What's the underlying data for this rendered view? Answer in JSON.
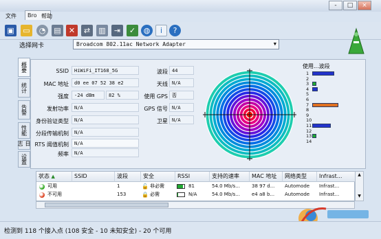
{
  "menu": {
    "file": "文件",
    "tab": "Bro",
    "help": "帮助"
  },
  "window_buttons": {
    "minimize": "-",
    "maximize": "□",
    "close": "×"
  },
  "adapter": {
    "label": "选择网卡",
    "selected": "Broadcom 802.11ac Network Adapter"
  },
  "side_tabs": [
    "概要",
    "统计",
    "告警",
    "性能",
    "日志",
    "设置"
  ],
  "details": {
    "ssid": {
      "label": "SSID",
      "value": "HiWiFi_IT168_5G"
    },
    "mac": {
      "label": "MAC 地址",
      "value": "d0 ee 07 52 38 e2"
    },
    "strength": {
      "label": "强度",
      "dbm": "-24 dBm",
      "pct": "82 %"
    },
    "tx_power": {
      "label": "发射功率",
      "value": "N/A"
    },
    "auth": {
      "label": "身份验证类型",
      "value": "N/A"
    },
    "frag": {
      "label": "分段传输机制",
      "value": "N/A"
    },
    "rts": {
      "label": "RTS 阈值机制",
      "value": "N/A"
    },
    "freq": {
      "label": "频率",
      "value": "N/A"
    },
    "band": {
      "label": "波段",
      "value": "44"
    },
    "antenna": {
      "label": "天线",
      "value": "N/A"
    },
    "gps": {
      "label": "使用 GPS",
      "value": "否"
    },
    "gps_signal": {
      "label": "GPS 信号",
      "value": "N/A"
    },
    "satellite": {
      "label": "卫星",
      "value": "N/A"
    }
  },
  "channel_usage": {
    "title": "使用...波段",
    "channels": [
      {
        "num": "1",
        "level": 0.75,
        "color": "#2233cc"
      },
      {
        "num": "2",
        "level": 0,
        "color": "#2233cc"
      },
      {
        "num": "3",
        "level": 0.1,
        "color": "#22aa33"
      },
      {
        "num": "4",
        "level": 0.2,
        "color": "#2233cc"
      },
      {
        "num": "5",
        "level": 0,
        "color": "#2233cc"
      },
      {
        "num": "6",
        "level": 0,
        "color": "#2233cc"
      },
      {
        "num": "7",
        "level": 0.9,
        "color": "#e07020"
      },
      {
        "num": "8",
        "level": 0,
        "color": "#2233cc"
      },
      {
        "num": "9",
        "level": 0,
        "color": "#2233cc"
      },
      {
        "num": "10",
        "level": 0,
        "color": "#2233cc"
      },
      {
        "num": "11",
        "level": 0.65,
        "color": "#2233cc"
      },
      {
        "num": "12",
        "level": 0,
        "color": "#2233cc"
      },
      {
        "num": "13",
        "level": 0.15,
        "color": "#22aa33"
      },
      {
        "num": "14",
        "level": 0,
        "color": "#2233cc"
      }
    ]
  },
  "table": {
    "headers": [
      "状态",
      "SSID",
      "波段",
      "安全",
      "RSSI",
      "支持的速率",
      "MAC 地址",
      "网络类型",
      "Infrast..."
    ],
    "rows": [
      {
        "status": "可用",
        "status_color": "#33aa22",
        "ssid": "",
        "band": "1",
        "security": "非必需",
        "rssi": "81",
        "rssi_level": 0.8,
        "rate": "54.0 Mb/s...",
        "mac": "38 97 d...",
        "net_type": "Automode",
        "infra": "Infrast..."
      },
      {
        "status": "不可用",
        "status_color": "#dd4422",
        "ssid": "",
        "band": "153",
        "security": "必需",
        "rssi": "N/A",
        "rssi_level": 0.1,
        "rate": "54.0 Mb/s...",
        "mac": "e4 a8 b...",
        "net_type": "Automode",
        "infra": "Infrast..."
      }
    ]
  },
  "status_bar": "检测到 118 个接入点 (108 安全 - 10 未知安全) - 20 个可用",
  "colors": {
    "accent": "#2f6fb0",
    "radar_inner": "#ff2200",
    "radar_outer": "#22c9a8"
  }
}
